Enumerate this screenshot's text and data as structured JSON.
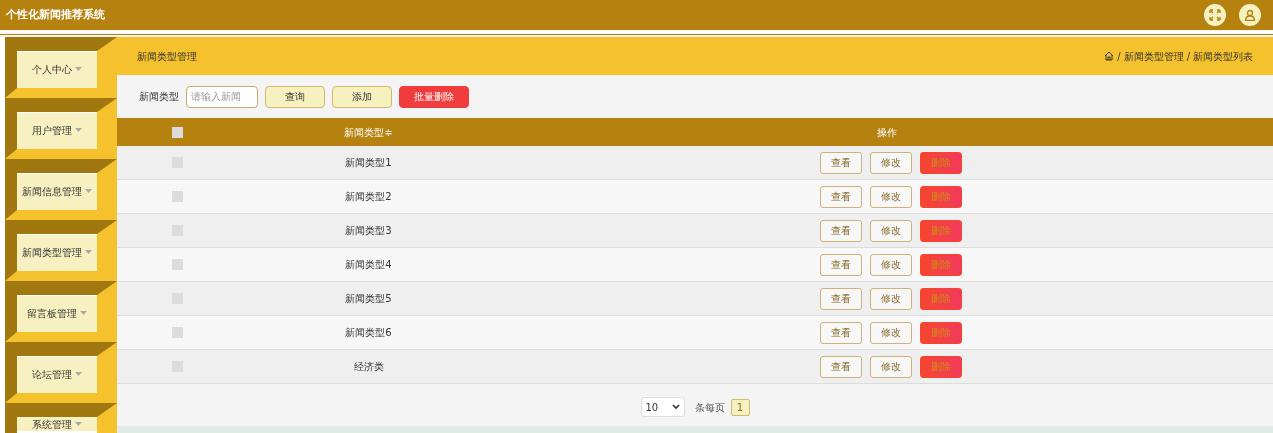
{
  "app_title": "个性化新闻推荐系统",
  "sidebar": {
    "items": [
      {
        "label": "个人中心",
        "selected": false
      },
      {
        "label": "用户管理",
        "selected": false
      },
      {
        "label": "新闻信息管理",
        "selected": false
      },
      {
        "label": "新闻类型管理",
        "selected": false
      },
      {
        "label": "留言板管理",
        "selected": false
      },
      {
        "label": "论坛管理",
        "selected": false
      },
      {
        "label": "系统管理",
        "selected": false
      }
    ]
  },
  "page_title": "新闻类型管理",
  "breadcrumb": [
    {
      "separator": "/",
      "label": "新闻类型管理"
    },
    {
      "separator": "/",
      "label": "新闻类型列表"
    }
  ],
  "search": {
    "label": "新闻类型",
    "placeholder": "请输入新闻"
  },
  "toolbar_buttons": [
    {
      "label": "查询",
      "kind": "normal"
    },
    {
      "label": "添加",
      "kind": "normal"
    },
    {
      "label": "批量删除",
      "kind": "danger"
    }
  ],
  "table": {
    "all_checked": false,
    "columns": [
      "新闻类型≑",
      "操作"
    ],
    "rows": [
      {
        "name": "新闻类型1",
        "checked": false,
        "actions": [
          {
            "label": "查看",
            "kind": "normal"
          },
          {
            "label": "修改",
            "kind": "normal"
          },
          {
            "label": "删除",
            "kind": "danger"
          }
        ]
      },
      {
        "name": "新闻类型2",
        "checked": false,
        "actions": [
          {
            "label": "查看",
            "kind": "normal"
          },
          {
            "label": "修改",
            "kind": "normal"
          },
          {
            "label": "删除",
            "kind": "danger"
          }
        ]
      },
      {
        "name": "新闻类型3",
        "checked": false,
        "actions": [
          {
            "label": "查看",
            "kind": "normal"
          },
          {
            "label": "修改",
            "kind": "normal"
          },
          {
            "label": "删除",
            "kind": "danger"
          }
        ]
      },
      {
        "name": "新闻类型4",
        "checked": false,
        "actions": [
          {
            "label": "查看",
            "kind": "normal"
          },
          {
            "label": "修改",
            "kind": "normal"
          },
          {
            "label": "删除",
            "kind": "danger"
          }
        ]
      },
      {
        "name": "新闻类型5",
        "checked": false,
        "actions": [
          {
            "label": "查看",
            "kind": "normal"
          },
          {
            "label": "修改",
            "kind": "normal"
          },
          {
            "label": "删除",
            "kind": "danger"
          }
        ]
      },
      {
        "name": "新闻类型6",
        "checked": false,
        "actions": [
          {
            "label": "查看",
            "kind": "normal"
          },
          {
            "label": "修改",
            "kind": "normal"
          },
          {
            "label": "删除",
            "kind": "danger"
          }
        ]
      },
      {
        "name": "经济类",
        "checked": false,
        "actions": [
          {
            "label": "查看",
            "kind": "normal"
          },
          {
            "label": "修改",
            "kind": "normal"
          },
          {
            "label": "删除",
            "kind": "danger"
          }
        ]
      }
    ]
  },
  "pagination": {
    "page_size": "10",
    "per_page_label": "条每页",
    "pages": [
      {
        "label": "1",
        "selected": true
      }
    ]
  }
}
